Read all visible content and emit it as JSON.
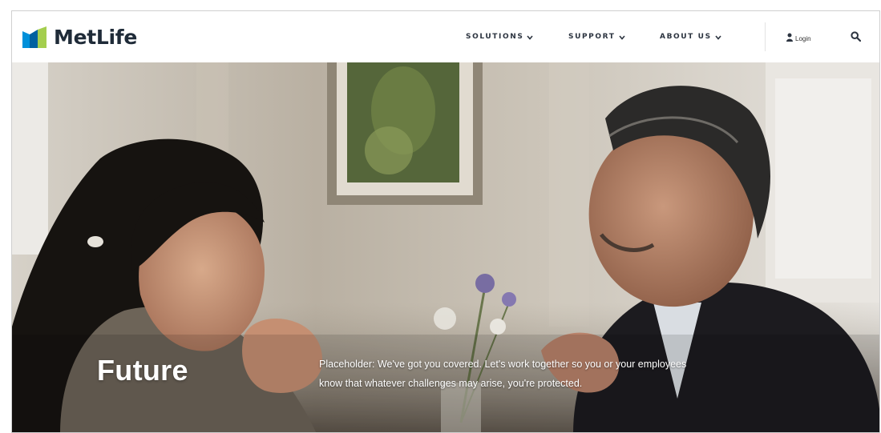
{
  "brand": {
    "name": "MetLife",
    "colors": {
      "blue": "#0090da",
      "green": "#a4ce4e",
      "text": "#1f2b38"
    }
  },
  "nav": {
    "items": [
      {
        "label": "SOLUTIONS"
      },
      {
        "label": "SUPPORT"
      },
      {
        "label": "ABOUT US"
      }
    ],
    "login_label": "Login",
    "login_icon": "user-icon",
    "search_icon": "search-icon"
  },
  "hero": {
    "title": "Future",
    "copy_line1": "Placeholder: We've got you covered. Let's work together so you or your employees",
    "copy_line2": "know that whatever challenges may arise, you're protected."
  }
}
